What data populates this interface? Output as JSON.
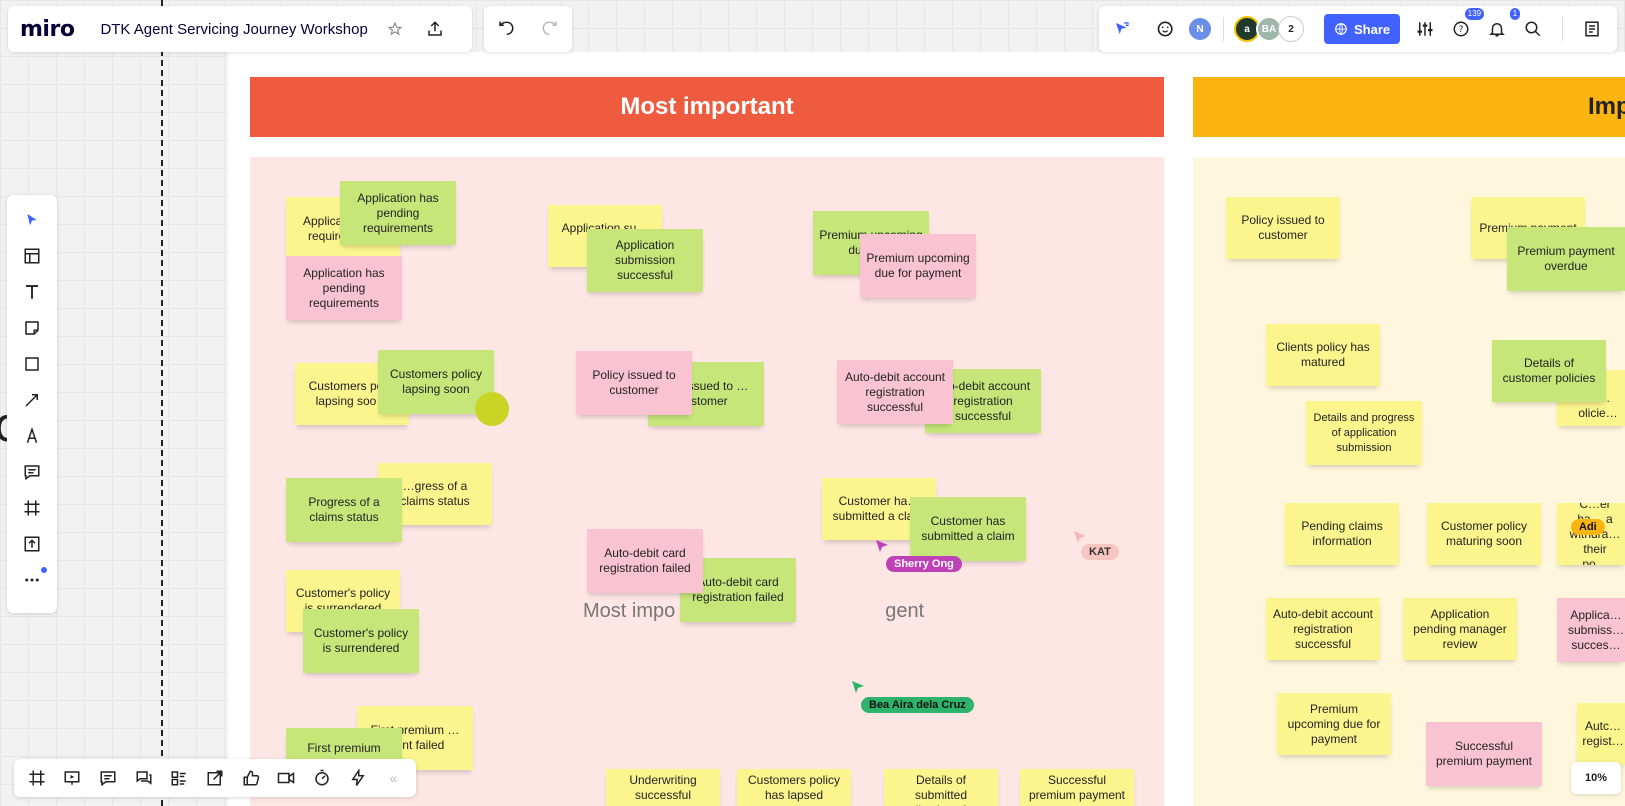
{
  "app": {
    "logo": "miro",
    "board_title": "DTK Agent Servicing Journey Workshop"
  },
  "topbar": {
    "star_icon": "star-icon",
    "export_icon": "upload-icon",
    "undo_icon": "undo-icon",
    "redo_icon": "redo-icon",
    "avatars": [
      "N",
      "a",
      "BA"
    ],
    "participant_count": "2",
    "share_label": "Share",
    "help_badge": "139",
    "notification_badge": "1"
  },
  "sections": {
    "most_important": "Most important",
    "important": "Imp"
  },
  "watermark": "Most impo",
  "watermark_end": "gent",
  "stickies": [
    {
      "id": "s1",
      "color": "y",
      "text": "Applica… pe… requirements"
    },
    {
      "id": "s2",
      "color": "g",
      "text": "Application has pending requirements"
    },
    {
      "id": "s3",
      "color": "p",
      "text": "Application has pending requirements"
    },
    {
      "id": "s4",
      "color": "y",
      "text": "Application su… s…"
    },
    {
      "id": "s5",
      "color": "g",
      "text": "Application submission successful"
    },
    {
      "id": "s6",
      "color": "g",
      "text": "Premium upcoming due fo…"
    },
    {
      "id": "s7",
      "color": "p",
      "text": "Premium upcoming due for payment"
    },
    {
      "id": "s8",
      "color": "y",
      "text": "Customers po… lapsing soo…"
    },
    {
      "id": "s9",
      "color": "g",
      "text": "Customers policy lapsing soon"
    },
    {
      "id": "s10",
      "color": "g",
      "text": "…y issued to …ustomer"
    },
    {
      "id": "s11",
      "color": "p",
      "text": "Policy issued to customer"
    },
    {
      "id": "s12",
      "color": "g",
      "text": "…o-debit account registration successful"
    },
    {
      "id": "s13",
      "color": "p",
      "text": "Auto-debit account registration successful"
    },
    {
      "id": "s14",
      "color": "y",
      "text": "…gress of a claims status"
    },
    {
      "id": "s15",
      "color": "g",
      "text": "Progress of a claims status"
    },
    {
      "id": "s16",
      "color": "y",
      "text": "Customer ha… submitted a cla…"
    },
    {
      "id": "s17",
      "color": "g",
      "text": "Customer has submitted a claim"
    },
    {
      "id": "s18",
      "color": "g",
      "text": "Auto-debit card registration failed"
    },
    {
      "id": "s19",
      "color": "p",
      "text": "Auto-debit card registration failed"
    },
    {
      "id": "s20",
      "color": "y",
      "text": "Customer's policy is surrendered"
    },
    {
      "id": "s21",
      "color": "g",
      "text": "Customer's policy is surrendered"
    },
    {
      "id": "s22",
      "color": "y",
      "text": "First premium …ment failed"
    },
    {
      "id": "s23",
      "color": "g",
      "text": "First premium"
    },
    {
      "id": "s24",
      "color": "y",
      "text": "Underwriting successful"
    },
    {
      "id": "s25",
      "color": "y",
      "text": "Customers policy has lapsed"
    },
    {
      "id": "s26",
      "color": "y",
      "text": "Details of submitted applications for a"
    },
    {
      "id": "s27",
      "color": "y",
      "text": "Successful premium payment"
    },
    {
      "id": "r1",
      "color": "y",
      "text": "Policy issued to customer"
    },
    {
      "id": "r2",
      "color": "y",
      "text": "Premium payment"
    },
    {
      "id": "r3",
      "color": "g",
      "text": "Premium payment overdue"
    },
    {
      "id": "r4",
      "color": "y",
      "text": "Clients policy has matured"
    },
    {
      "id": "r5",
      "color": "y",
      "text": "…f cu… olicie…"
    },
    {
      "id": "r6",
      "color": "g",
      "text": "Details of customer policies"
    },
    {
      "id": "r7",
      "color": "y",
      "text": "Details and progress of application submission"
    },
    {
      "id": "r8",
      "color": "y",
      "text": "Pending claims information"
    },
    {
      "id": "r9",
      "color": "y",
      "text": "Customer policy maturing soon"
    },
    {
      "id": "r10",
      "color": "y",
      "text": "C…er ha… a withdra… their po…"
    },
    {
      "id": "r11",
      "color": "y",
      "text": "Auto-debit account registration successful"
    },
    {
      "id": "r12",
      "color": "y",
      "text": "Application pending manager review"
    },
    {
      "id": "r13",
      "color": "p",
      "text": "Applica… submiss… succes…"
    },
    {
      "id": "r14",
      "color": "y",
      "text": "Premium upcoming due for payment"
    },
    {
      "id": "r15",
      "color": "p",
      "text": "Successful premium payment"
    },
    {
      "id": "r16",
      "color": "y",
      "text": "Autc… regist…"
    }
  ],
  "cursors": [
    {
      "name": "Sherry Ong",
      "color": "#c040b8"
    },
    {
      "name": "KAT",
      "color": "#f7b8b8"
    },
    {
      "name": "Bea Aira dela Cruz",
      "color": "#2db36b"
    },
    {
      "name": "Adi",
      "color": "#fcb510"
    }
  ],
  "zoom": "10%",
  "colors": {
    "share": "#4262ff",
    "header_red": "#ee5b3f",
    "header_yellow": "#fcb510",
    "pink_area": "#fde6e3",
    "cream_area": "#fff7dd"
  }
}
